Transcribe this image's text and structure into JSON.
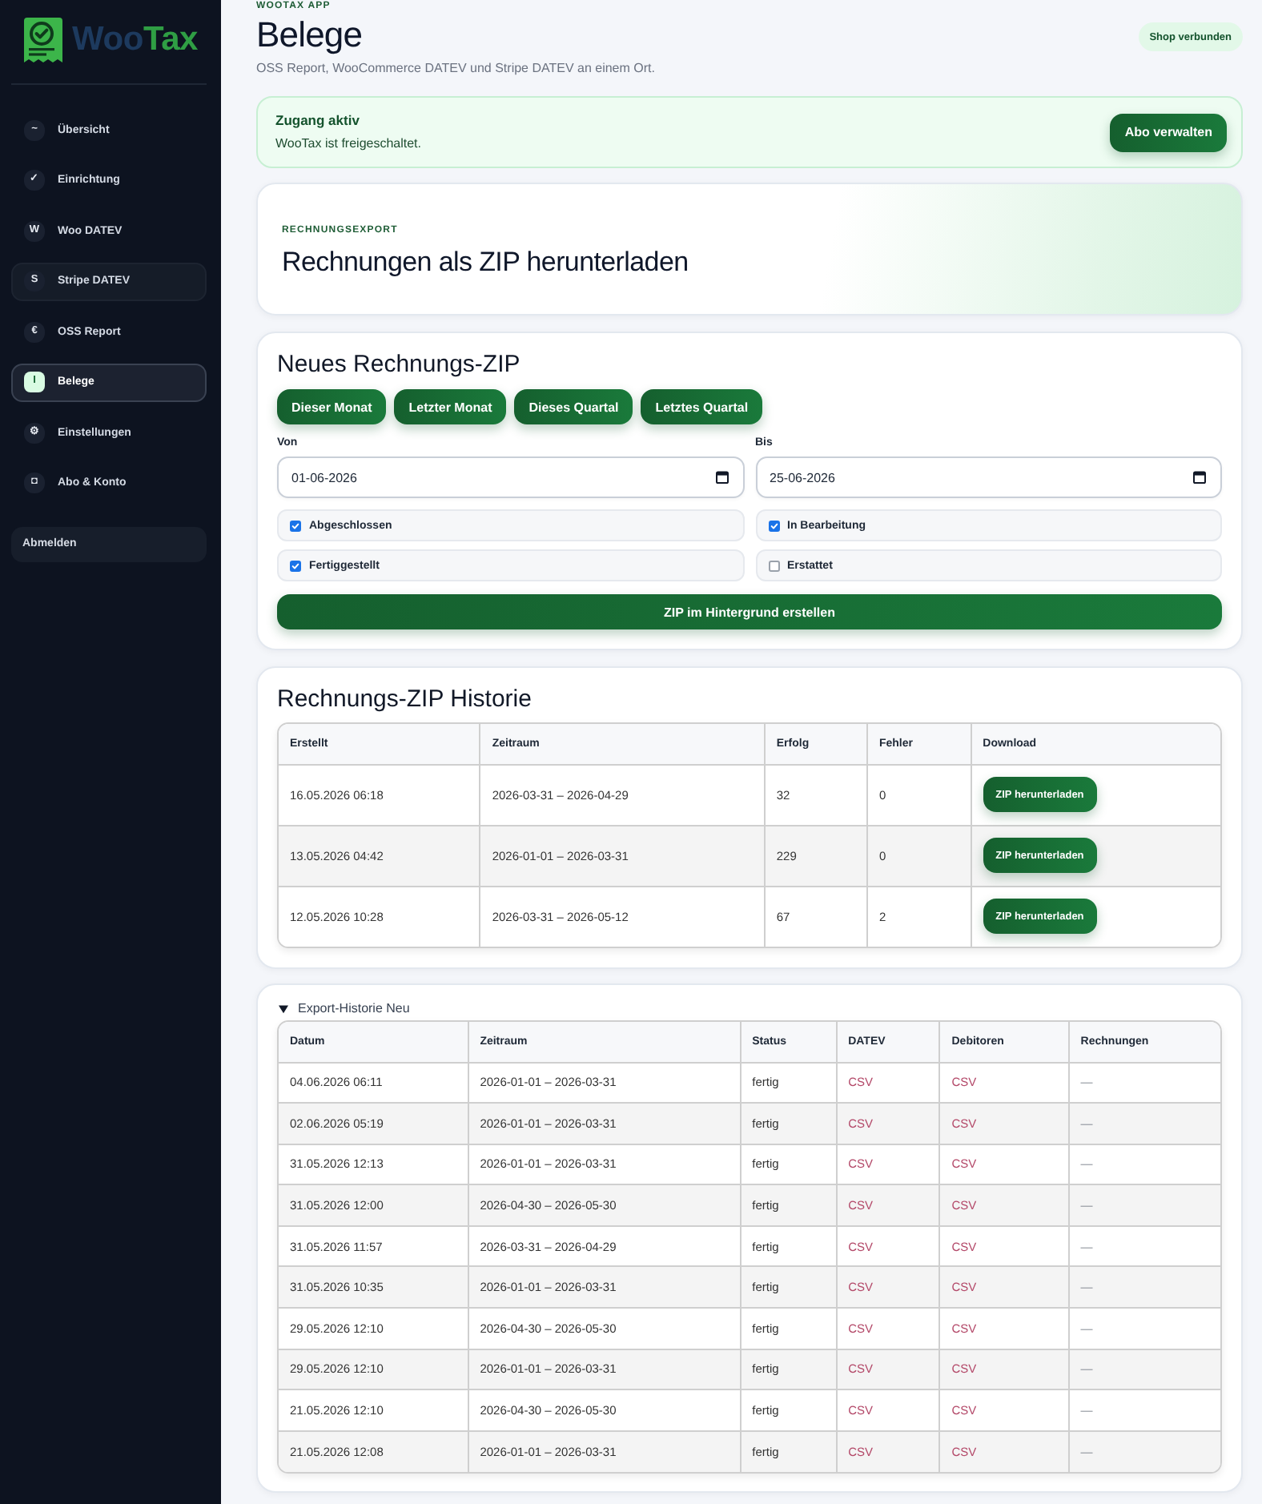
{
  "sidebar": {
    "logo": {
      "parts": [
        {
          "text": "Woo",
          "color": "#1d3a5e"
        },
        {
          "text": "Tax",
          "color": "#2f9e44"
        }
      ]
    },
    "items": [
      {
        "icon": "~",
        "label": "Übersicht",
        "selected": false,
        "hovered": false
      },
      {
        "icon": "✓",
        "label": "Einrichtung",
        "selected": false,
        "hovered": false
      },
      {
        "icon": "W",
        "label": "Woo DATEV",
        "selected": false,
        "hovered": false
      },
      {
        "icon": "S",
        "label": "Stripe DATEV",
        "selected": false,
        "hovered": true
      },
      {
        "icon": "€",
        "label": "OSS Report",
        "selected": false,
        "hovered": false
      },
      {
        "icon": "I",
        "label": "Belege",
        "selected": true,
        "hovered": false
      },
      {
        "icon": "⚙",
        "label": "Einstellungen",
        "selected": false,
        "hovered": false
      },
      {
        "icon": "◘",
        "label": "Abo & Konto",
        "selected": false,
        "hovered": false
      }
    ],
    "logout": "Abmelden"
  },
  "header": {
    "eyebrow": "WOOTAX APP",
    "title": "Belege",
    "subtitle": "OSS Report, WooCommerce DATEV und Stripe DATEV an einem Ort.",
    "badge": "Shop verbunden"
  },
  "access": {
    "title": "Zugang aktiv",
    "text": "WooTax ist freigeschaltet.",
    "button": "Abo verwalten"
  },
  "hero": {
    "eyebrow": "RECHNUNGSEXPORT",
    "title": "Rechnungen als ZIP herunterladen"
  },
  "new_zip": {
    "title": "Neues Rechnungs-ZIP",
    "presets": [
      "Dieser Monat",
      "Letzter Monat",
      "Dieses Quartal",
      "Letztes Quartal"
    ],
    "from": {
      "label": "Von",
      "value": "01-06-2026"
    },
    "to": {
      "label": "Bis",
      "value": "25-06-2026"
    },
    "statuses": [
      {
        "label": "Abgeschlossen",
        "checked": true
      },
      {
        "label": "In Bearbeitung",
        "checked": true
      },
      {
        "label": "Fertiggestellt",
        "checked": true
      },
      {
        "label": "Erstattet",
        "checked": false
      }
    ],
    "submit": "ZIP im Hintergrund erstellen"
  },
  "zip_history": {
    "title": "Rechnungs-ZIP Historie",
    "columns": [
      "Erstellt",
      "Zeitraum",
      "Erfolg",
      "Fehler",
      "Download"
    ],
    "rows": [
      {
        "created": "16.05.2026 06:18",
        "period": "2026-03-31 – 2026-04-29",
        "success": "32",
        "errors": "0",
        "download": "ZIP herunterladen"
      },
      {
        "created": "13.05.2026 04:42",
        "period": "2026-01-01 – 2026-03-31",
        "success": "229",
        "errors": "0",
        "download": "ZIP herunterladen"
      },
      {
        "created": "12.05.2026 10:28",
        "period": "2026-03-31 – 2026-05-12",
        "success": "67",
        "errors": "2",
        "download": "ZIP herunterladen"
      }
    ]
  },
  "export_history": {
    "title": "Export-Historie Neu",
    "expanded": true,
    "columns": [
      "Datum",
      "Zeitraum",
      "Status",
      "DATEV",
      "Debitoren",
      "Rechnungen"
    ],
    "rows": [
      {
        "date": "04.06.2026 06:11",
        "period": "2026-01-01 – 2026-03-31",
        "status": "fertig",
        "datev": "CSV",
        "debitoren": "CSV",
        "invoices": "—"
      },
      {
        "date": "02.06.2026 05:19",
        "period": "2026-01-01 – 2026-03-31",
        "status": "fertig",
        "datev": "CSV",
        "debitoren": "CSV",
        "invoices": "—"
      },
      {
        "date": "31.05.2026 12:13",
        "period": "2026-01-01 – 2026-03-31",
        "status": "fertig",
        "datev": "CSV",
        "debitoren": "CSV",
        "invoices": "—"
      },
      {
        "date": "31.05.2026 12:00",
        "period": "2026-04-30 – 2026-05-30",
        "status": "fertig",
        "datev": "CSV",
        "debitoren": "CSV",
        "invoices": "—"
      },
      {
        "date": "31.05.2026 11:57",
        "period": "2026-03-31 – 2026-04-29",
        "status": "fertig",
        "datev": "CSV",
        "debitoren": "CSV",
        "invoices": "—"
      },
      {
        "date": "31.05.2026 10:35",
        "period": "2026-01-01 – 2026-03-31",
        "status": "fertig",
        "datev": "CSV",
        "debitoren": "CSV",
        "invoices": "—"
      },
      {
        "date": "29.05.2026 12:10",
        "period": "2026-04-30 – 2026-05-30",
        "status": "fertig",
        "datev": "CSV",
        "debitoren": "CSV",
        "invoices": "—"
      },
      {
        "date": "29.05.2026 12:10",
        "period": "2026-01-01 – 2026-03-31",
        "status": "fertig",
        "datev": "CSV",
        "debitoren": "CSV",
        "invoices": "—"
      },
      {
        "date": "21.05.2026 12:10",
        "period": "2026-04-30 – 2026-05-30",
        "status": "fertig",
        "datev": "CSV",
        "debitoren": "CSV",
        "invoices": "—"
      },
      {
        "date": "21.05.2026 12:08",
        "period": "2026-01-01 – 2026-03-31",
        "status": "fertig",
        "datev": "CSV",
        "debitoren": "CSV",
        "invoices": "—"
      }
    ]
  }
}
